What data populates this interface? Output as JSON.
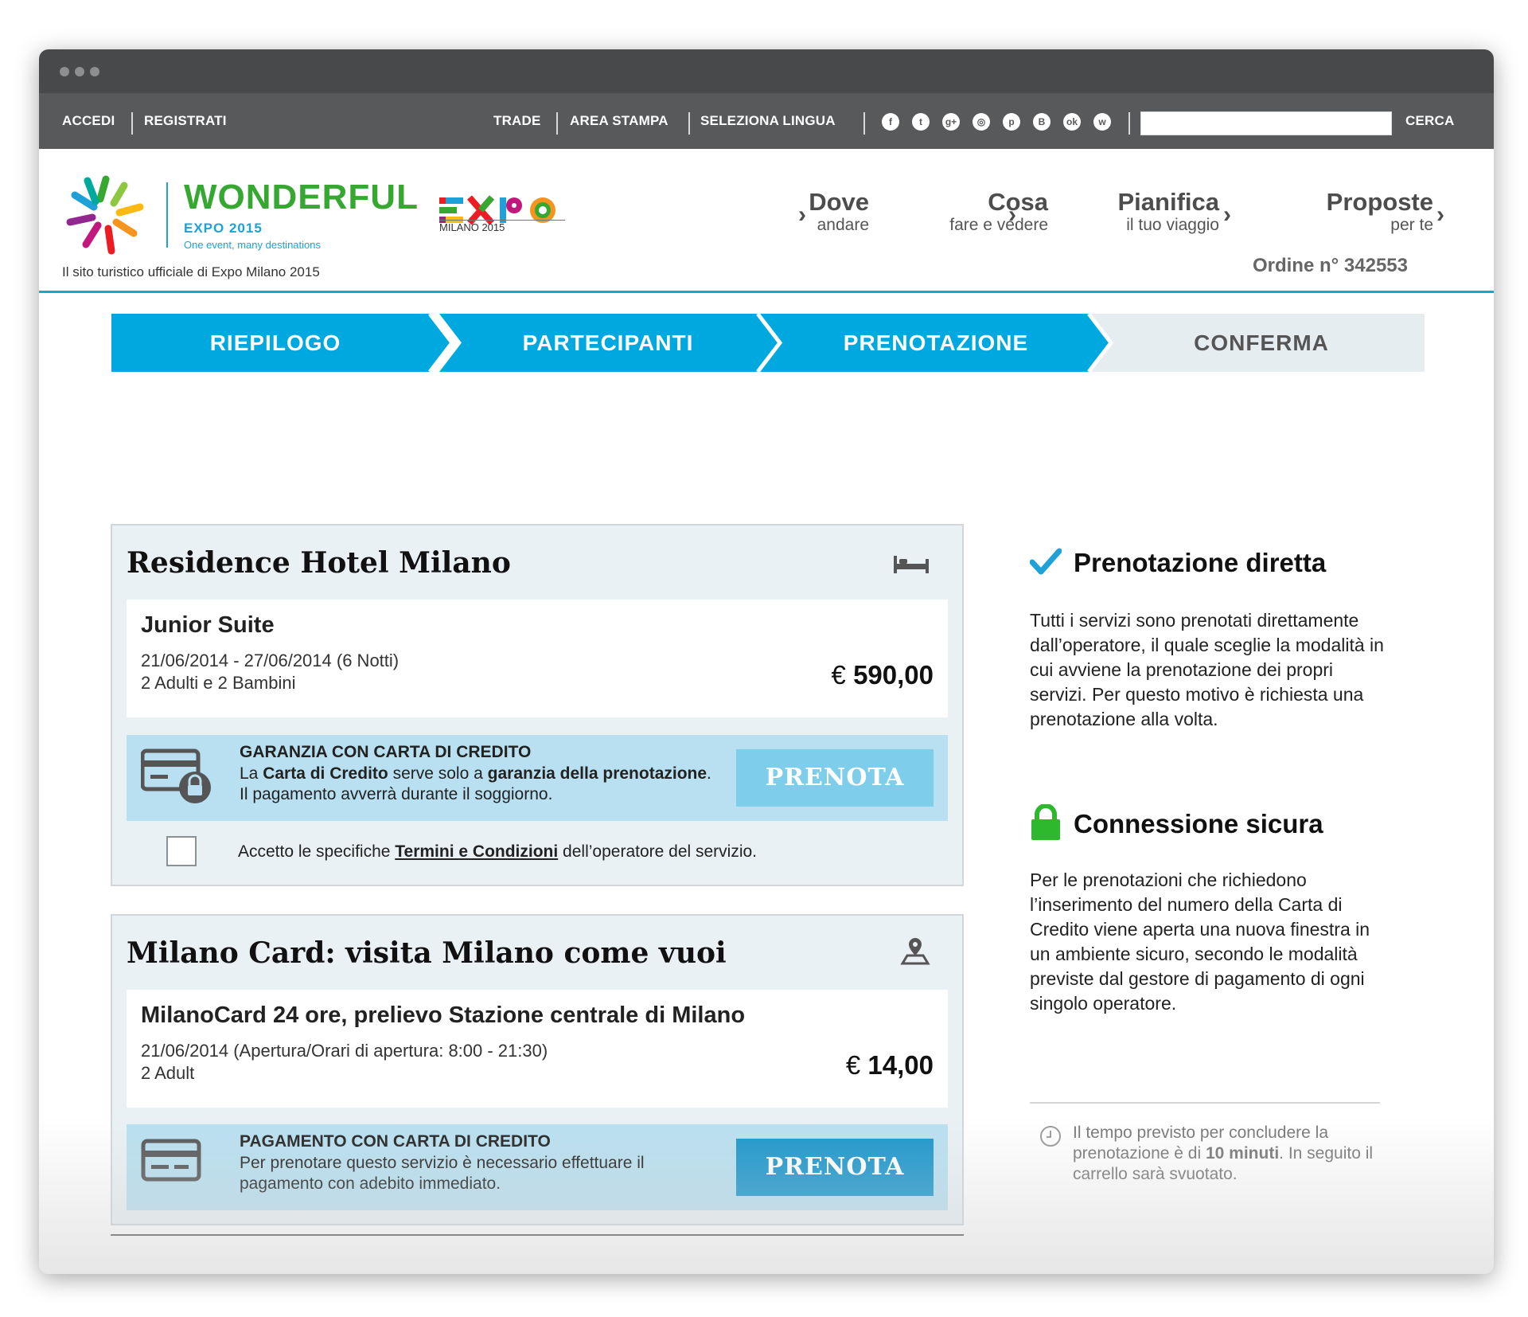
{
  "topbar": {
    "accedi": "ACCEDI",
    "registrati": "REGISTRATI",
    "trade": "TRADE",
    "area_stampa": "AREA STAMPA",
    "seleziona_lingua": "SELEZIONA LINGUA",
    "search_value": "",
    "cerca": "CERCA",
    "social_icons": [
      "facebook-icon",
      "twitter-icon",
      "google-plus-icon",
      "instagram-icon",
      "pinterest-icon",
      "vkontakte-icon",
      "odnoklassniki-icon",
      "weibo-icon"
    ],
    "social_glyphs": [
      "f",
      "t",
      "g+",
      "◎",
      "p",
      "B",
      "ok",
      "w"
    ]
  },
  "brand": {
    "wonderful": "WONDERFUL",
    "expo2015": "EXPO 2015",
    "tagline": "One event, many destinations",
    "expo_logo_text": "EXPO",
    "milano2015": "MILANO 2015",
    "official": "Il sito turistico ufficiale di Expo Milano 2015"
  },
  "nav": [
    {
      "main": "Dove",
      "sub": "andare"
    },
    {
      "main": "Cosa",
      "sub": "fare e vedere"
    },
    {
      "main": "Pianifica",
      "sub": "il tuo viaggio"
    },
    {
      "main": "Proposte",
      "sub": "per te"
    }
  ],
  "order": "Ordine n° 342553",
  "steps": [
    {
      "label": "RIEPILOGO",
      "state": "done"
    },
    {
      "label": "PARTECIPANTI",
      "state": "done"
    },
    {
      "label": "PRENOTAZIONE",
      "state": "active"
    },
    {
      "label": "CONFERMA",
      "state": "pending"
    }
  ],
  "colors": {
    "accent": "#00a8e0",
    "step_pending": "#e6edf1",
    "btn_active": "#1a96cc",
    "btn_disabled": "#7ecdea",
    "green": "#2eb82e",
    "check": "#1da1d8"
  },
  "bookings": [
    {
      "title": "Residence Hotel Milano",
      "icon": "bed-icon",
      "item": "Junior Suite",
      "line1": "21/06/2014 - 27/06/2014 (6 Notti)",
      "line2": "2 Adulti e 2 Bambini",
      "currency": "€",
      "price": "590,00",
      "pay_icon": "credit-card-lock-icon",
      "pay_title": "GARANZIA CON CARTA DI CREDITO",
      "pay_text_1": "La ",
      "pay_text_b1": "Carta di Credito",
      "pay_text_2": " serve solo a ",
      "pay_text_b2": "garanzia della prenotazione",
      "pay_text_3": ". Il pagamento avverrà durante il soggiorno.",
      "button": "PRENOTA",
      "button_enabled": false,
      "terms_1": "Accetto le specifiche ",
      "terms_link": "Termini e Condizioni",
      "terms_2": " dell’operatore del servizio.",
      "terms_checked": false
    },
    {
      "title": "Milano Card: visita Milano come vuoi",
      "icon": "map-pin-icon",
      "item": "MilanoCard 24 ore, prelievo Stazione centrale di Milano",
      "line1": "21/06/2014 (Apertura/Orari di apertura: 8:00 - 21:30)",
      "line2": "2 Adult",
      "currency": "€",
      "price": "14,00",
      "pay_icon": "credit-card-icon",
      "pay_title": "PAGAMENTO CON CARTA DI CREDITO",
      "pay_text": "Per prenotare questo servizio è necessario effettuare il pagamento con adebito immediato.",
      "button": "PRENOTA",
      "button_enabled": true
    }
  ],
  "sidebar": {
    "direct_title": "Prenotazione diretta",
    "direct_text": "Tutti i servizi sono prenotati direttamente dall’operatore, il quale sceglie la modalità in cui avviene la prenotazione dei propri servizi. Per questo motivo è richiesta una prenotazione alla volta.",
    "secure_title": "Connessione sicura",
    "secure_text": "Per le prenotazioni che richiedono l’inserimento del numero della Carta di Credito viene aperta una nuova finestra in un ambiente sicuro, secondo le modalità previste dal gestore di pagamento di ogni singolo operatore.",
    "timer_1": "Il tempo previsto per concludere la prenotazione è di ",
    "timer_b": "10 minuti",
    "timer_2": ". In seguito il carrello sarà svuotato."
  }
}
